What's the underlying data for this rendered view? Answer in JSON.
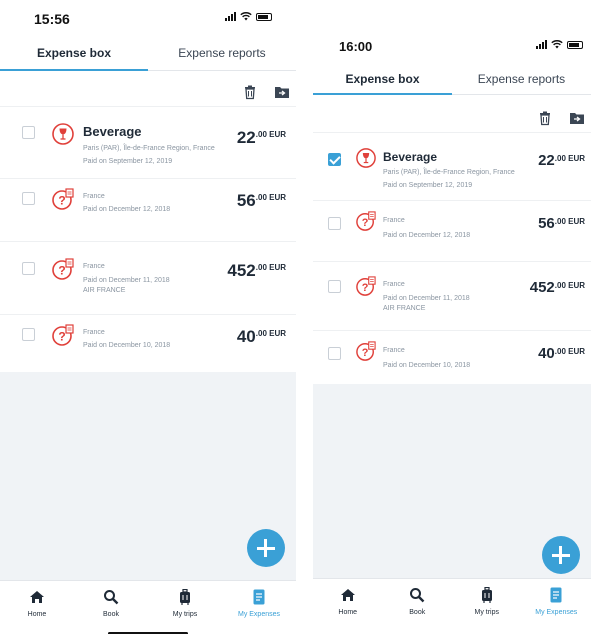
{
  "screens": [
    {
      "time": "15:56",
      "tabs": [
        "Expense box",
        "Expense reports"
      ],
      "active_tab": 0,
      "expenses": [
        {
          "title": "Beverage",
          "location": "Paris (PAR), Île-de-France Region, France",
          "paid": "Paid on September 12, 2019",
          "extra": "",
          "amount": "22",
          "decimals": ".00 EUR",
          "icon": "wine-glass-icon",
          "checked": false
        },
        {
          "title": "",
          "location": "France",
          "paid": "Paid on December 12, 2018",
          "extra": "",
          "amount": "56",
          "decimals": ".00 EUR",
          "icon": "unknown-receipt-icon",
          "checked": false
        },
        {
          "title": "",
          "location": "France",
          "paid": "Paid on December 11, 2018",
          "extra": "AIR FRANCE",
          "amount": "452",
          "decimals": ".00 EUR",
          "icon": "unknown-receipt-icon",
          "checked": false
        },
        {
          "title": "",
          "location": "France",
          "paid": "Paid on December 10, 2018",
          "extra": "",
          "amount": "40",
          "decimals": ".00 EUR",
          "icon": "unknown-receipt-icon",
          "checked": false
        }
      ],
      "nav": [
        "Home",
        "Book",
        "My trips",
        "My Expenses"
      ],
      "active_nav": 3
    },
    {
      "time": "16:00",
      "tabs": [
        "Expense box",
        "Expense reports"
      ],
      "active_tab": 0,
      "expenses": [
        {
          "title": "Beverage",
          "location": "Paris (PAR), Île-de-France Region, France",
          "paid": "Paid on September 12, 2019",
          "extra": "",
          "amount": "22",
          "decimals": ".00 EUR",
          "icon": "wine-glass-icon",
          "checked": true
        },
        {
          "title": "",
          "location": "France",
          "paid": "Paid on December 12, 2018",
          "extra": "",
          "amount": "56",
          "decimals": ".00 EUR",
          "icon": "unknown-receipt-icon",
          "checked": false
        },
        {
          "title": "",
          "location": "France",
          "paid": "Paid on December 11, 2018",
          "extra": "AIR FRANCE",
          "amount": "452",
          "decimals": ".00 EUR",
          "icon": "unknown-receipt-icon",
          "checked": false
        },
        {
          "title": "",
          "location": "France",
          "paid": "Paid on December 10, 2018",
          "extra": "",
          "amount": "40",
          "decimals": ".00 EUR",
          "icon": "unknown-receipt-icon",
          "checked": false
        }
      ],
      "nav": [
        "Home",
        "Book",
        "My trips",
        "My Expenses"
      ],
      "active_nav": 3
    }
  ],
  "toolbar_icons": [
    "trash-icon",
    "move-to-folder-icon"
  ],
  "nav_icons": [
    "home-icon",
    "search-icon",
    "suitcase-icon",
    "expense-document-icon"
  ],
  "colors": {
    "accent": "#3aa0d6",
    "category_red": "#e0403a",
    "background_empty": "#f0f3f6",
    "text_primary": "#1f2a37",
    "text_secondary": "#8a95a1"
  }
}
